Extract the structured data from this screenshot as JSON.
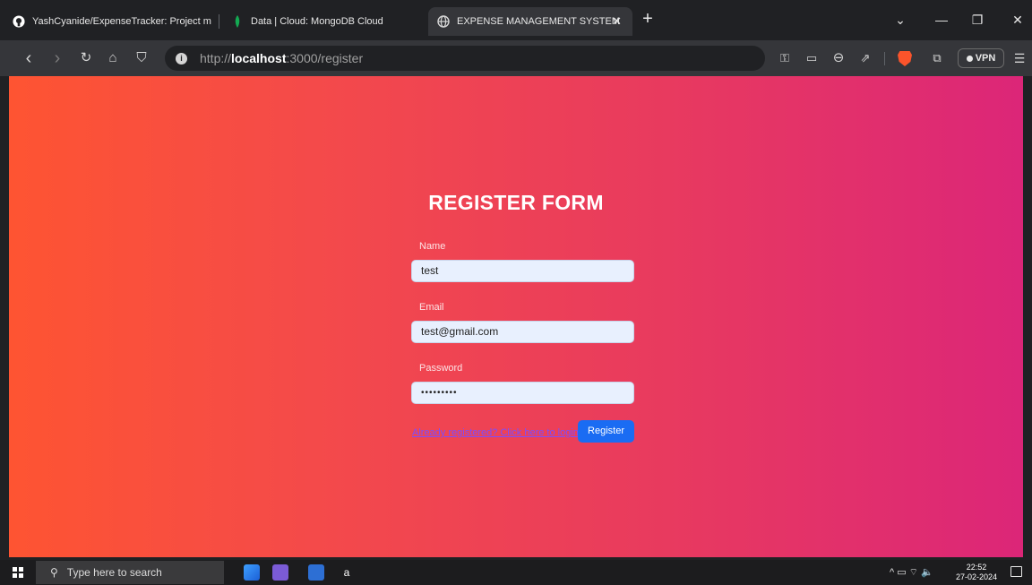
{
  "browser": {
    "tabs": [
      {
        "label": "YashCyanide/ExpenseTracker: Project m"
      },
      {
        "label": "Data | Cloud: MongoDB Cloud"
      },
      {
        "label": "EXPENSE MANAGEMENT SYSTEM",
        "close": "✕"
      }
    ],
    "new_tab": "+",
    "window_controls": {
      "dropdown": "⌄",
      "minimize": "—",
      "maximize": "❐",
      "close": "✕"
    },
    "nav": {
      "back": "‹",
      "forward": "›",
      "reload": "↻",
      "home": "⌂",
      "bookmark": "⛉"
    },
    "url": {
      "prefix": "http://",
      "host": "localhost",
      "rest": ":3000/register"
    },
    "toolbar": {
      "key": "⚿",
      "cast": "▭",
      "zoom": "⊖",
      "share": "⇗",
      "extensions": "⧉",
      "menu": "☰"
    },
    "vpn_label": "VPN"
  },
  "form": {
    "title": "REGISTER FORM",
    "fields": [
      {
        "label": "Name",
        "value": "test"
      },
      {
        "label": "Email",
        "value": "test@gmail.com"
      },
      {
        "label": "Password",
        "value": "•••••••••"
      }
    ],
    "login_link": "Already registered? Click here to login",
    "submit_label": "Register"
  },
  "taskbar": {
    "search_placeholder": "Type here to search",
    "tray_icons": "^  ▭  ⌔  🔈",
    "time": "22:52",
    "date": "27-02-2024"
  },
  "colors": {
    "gradient_start": "#fe5432",
    "gradient_end": "#dc2678",
    "register_button": "#1a6cf3",
    "link": "#7b4dff"
  }
}
